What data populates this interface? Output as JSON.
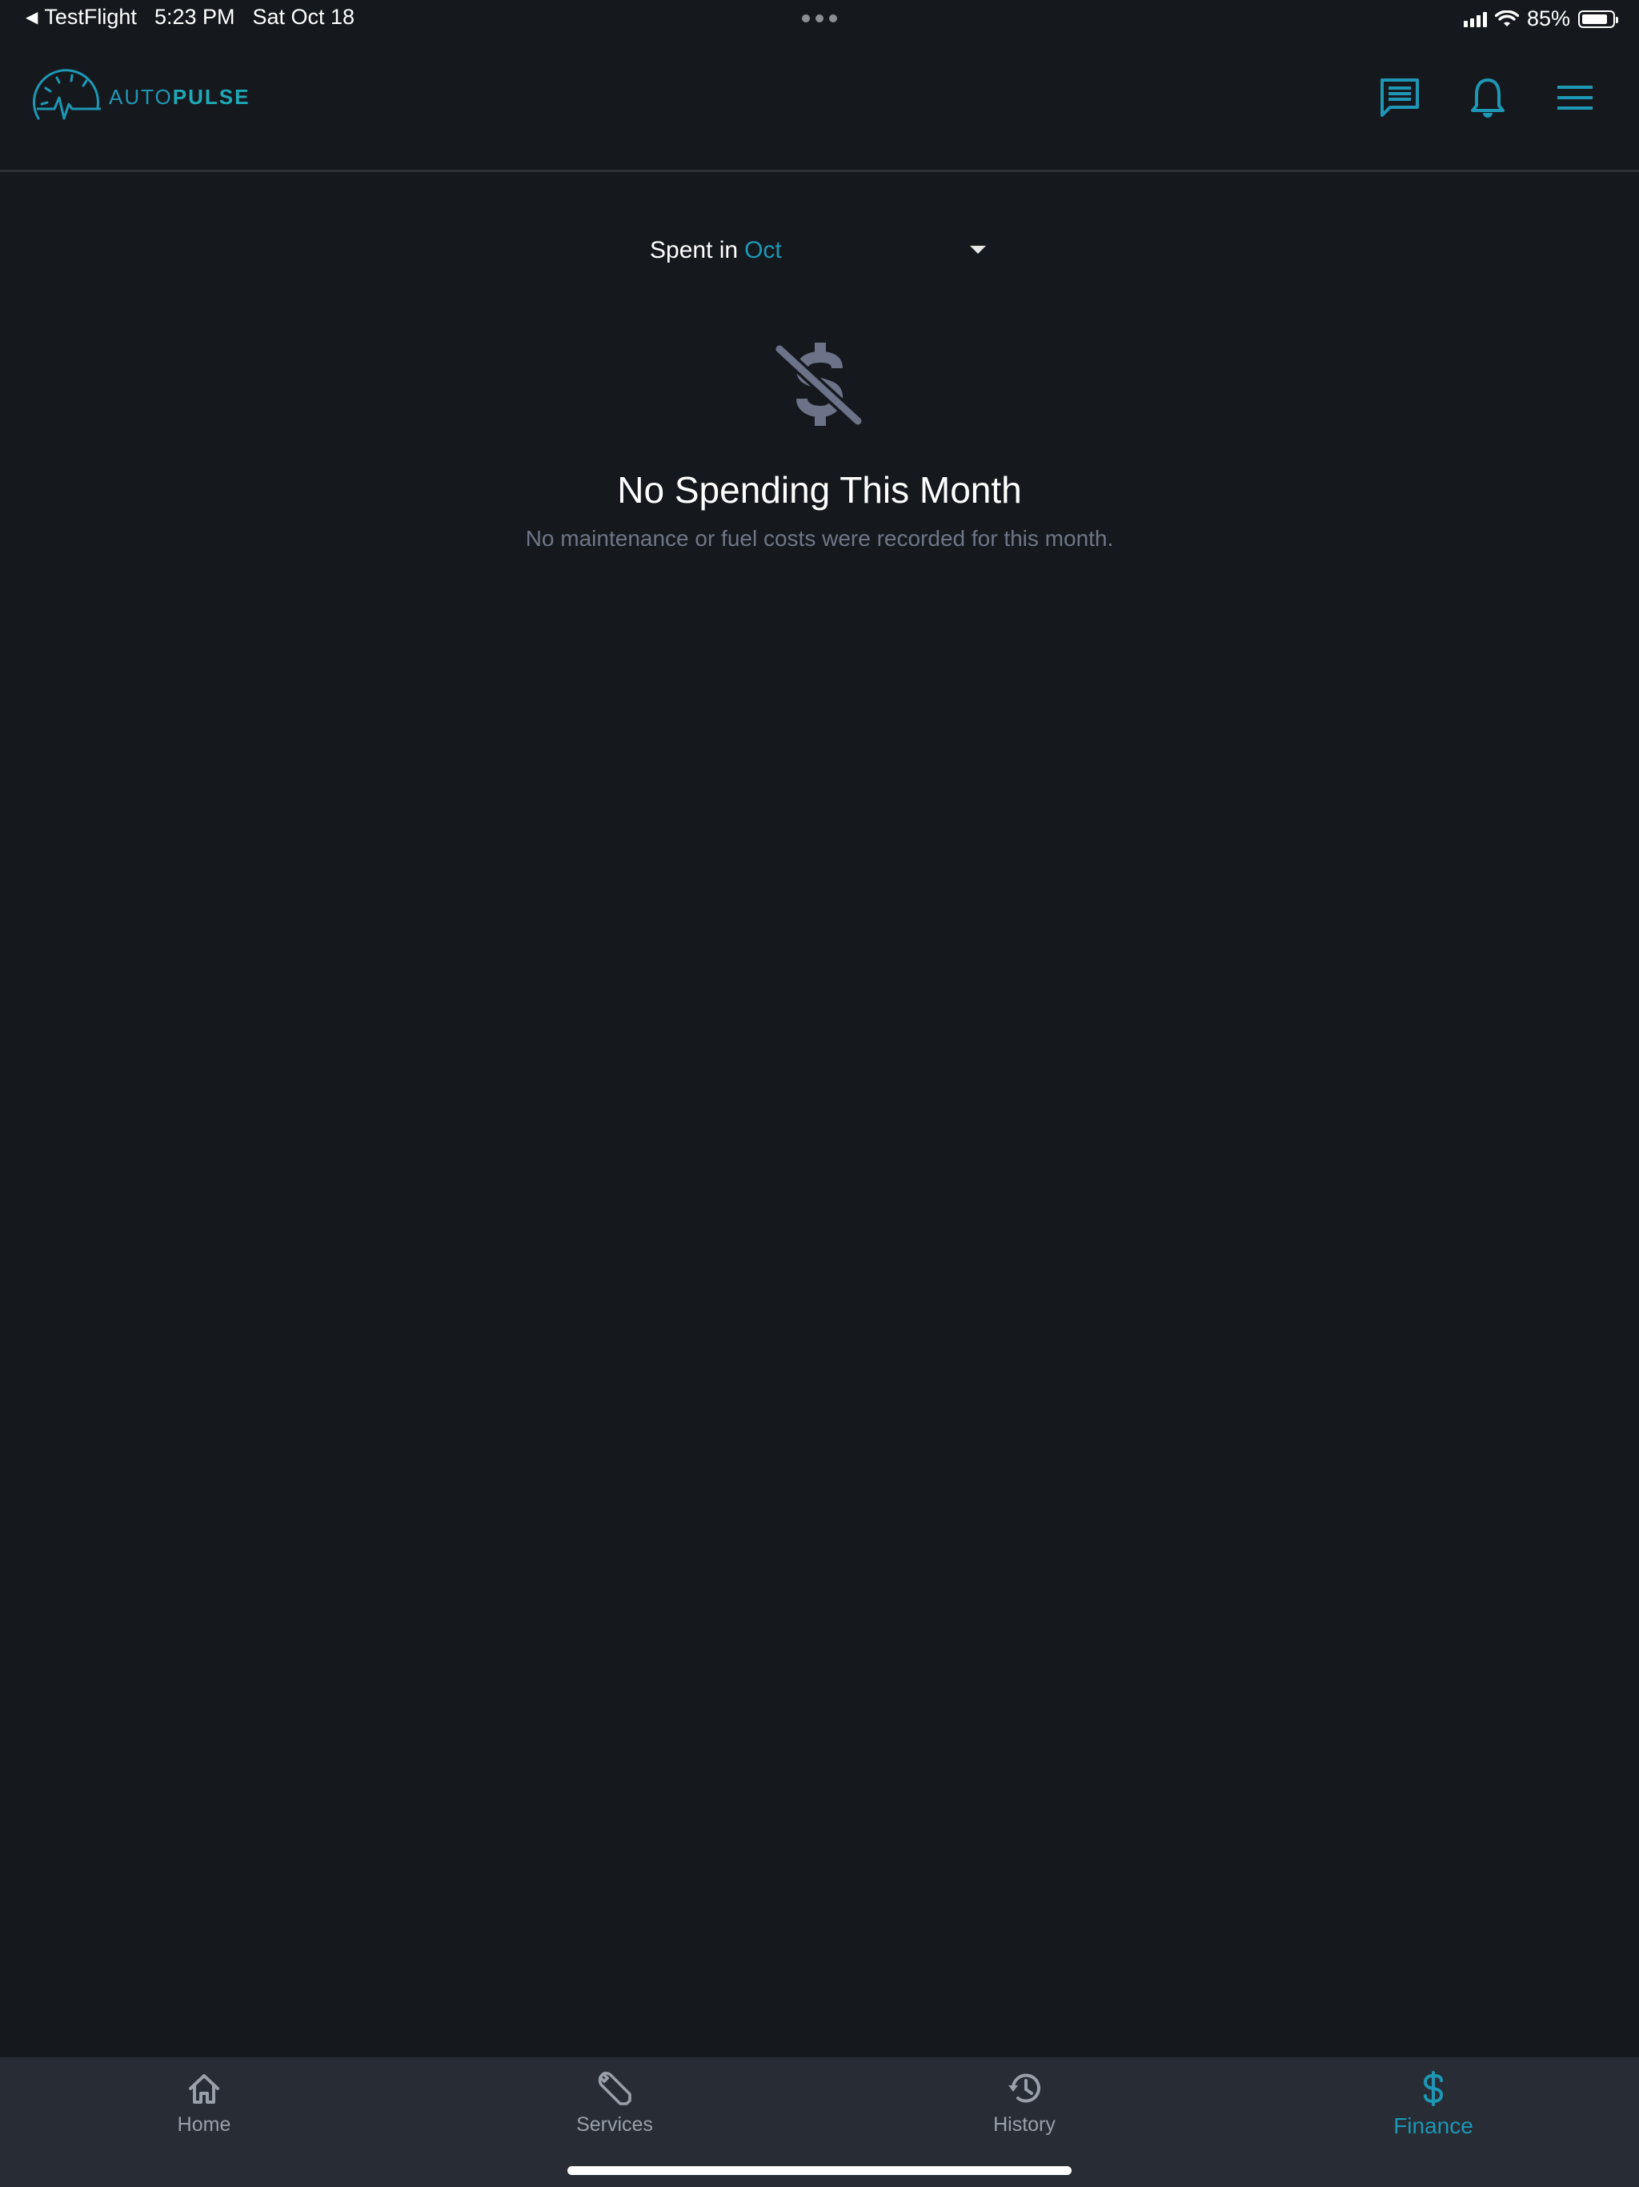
{
  "status_bar": {
    "back_arrow": "◀",
    "back_app": "TestFlight",
    "time": "5:23 PM",
    "date": "Sat Oct 18",
    "battery_percent": "85%",
    "battery_level": 0.85
  },
  "header": {
    "logo_text_light": "AUTO",
    "logo_text_bold": "PULSE",
    "icons": [
      "chat-icon",
      "bell-icon",
      "menu-icon"
    ]
  },
  "month_selector": {
    "label": "Spent in",
    "value": "Oct"
  },
  "empty_state": {
    "icon": "no-money-icon",
    "title": "No Spending This Month",
    "subtitle": "No maintenance or fuel costs were recorded for this month."
  },
  "tabs": [
    {
      "label": "Home",
      "icon": "home-icon",
      "active": false
    },
    {
      "label": "Services",
      "icon": "wrench-icon",
      "active": false
    },
    {
      "label": "History",
      "icon": "history-icon",
      "active": false
    },
    {
      "label": "Finance",
      "icon": "dollar-icon",
      "active": true
    }
  ],
  "colors": {
    "background": "#15191d",
    "accent": "#1e97b5",
    "tabbar": "#272c35",
    "muted_text": "#6f7686",
    "empty_icon": "#6c7389"
  }
}
